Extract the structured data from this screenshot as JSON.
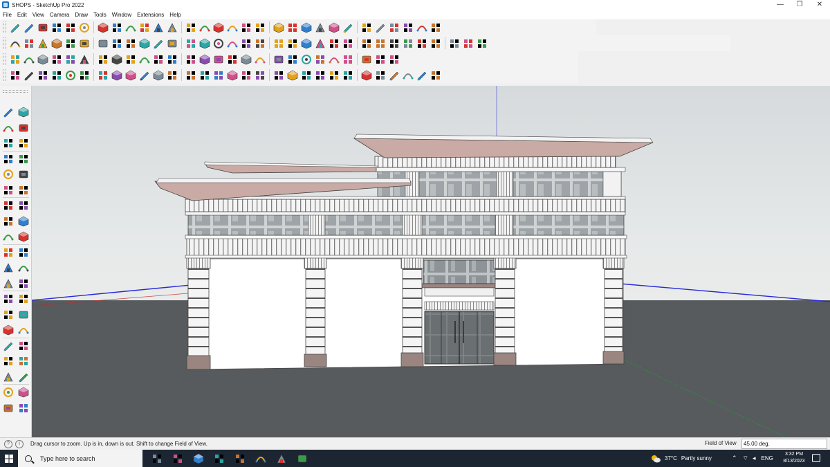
{
  "window": {
    "title": "SHOPS - SketchUp Pro 2022",
    "minimize_glyph": "—",
    "restore_glyph": "❐",
    "close_glyph": "✕"
  },
  "menu": [
    "File",
    "Edit",
    "View",
    "Camera",
    "Draw",
    "Tools",
    "Window",
    "Extensions",
    "Help"
  ],
  "toolbar_icons": {
    "row1": [
      "zoom-icon",
      "select-icon",
      "eraser-icon",
      "line-icon",
      "arc-icon",
      "rectangle-icon",
      "push-pull-icon",
      "follow-me-icon",
      "move-icon",
      "rotate-icon",
      "scale-icon",
      "tape-measure-icon",
      "text-icon",
      "paint-bucket-icon",
      "orbit-icon",
      "pan-icon",
      "zoom-window-icon",
      "zoom-extents-icon",
      "warehouse-icon",
      "layers-icon",
      "styles-icon",
      "account-icon",
      "section-plane-icon",
      "section-fill-icon",
      "axes-icon",
      "sandbox-icon",
      "solid-tools-icon",
      "undo-icon",
      "redo-icon",
      "sun-icon"
    ],
    "row2": [
      "iso-view-icon",
      "top-view-icon",
      "front-view-icon",
      "right-view-icon",
      "back-view-icon",
      "left-view-icon",
      "bottom-view-icon",
      "xray-icon",
      "wireframe-icon",
      "hidden-line-icon",
      "shaded-icon",
      "textured-icon",
      "monochrome-icon",
      "component-icon",
      "group-icon",
      "house-icon",
      "door-icon",
      "window-icon",
      "text-style-icon",
      "pencil-icon",
      "eraser-red-icon",
      "ring-icon",
      "ellipse-icon",
      "circle-icon",
      "polygon-icon",
      "grid-icon",
      "align-icon",
      "flip-icon",
      "join-icon",
      "render-icon",
      "texture-icon",
      "tag-icon",
      "box-icon"
    ],
    "row3": [
      "solid-union-icon",
      "offset-icon",
      "move-array-icon",
      "fillet-icon",
      "round-corner-icon",
      "bezier-icon",
      "intersect-icon",
      "extrude-icon",
      "curve-icon",
      "loft-icon",
      "weld-icon",
      "split-icon",
      "triangle-icon",
      "shell-icon",
      "cut-icon",
      "magnet-icon",
      "frame-icon",
      "subdivide-icon",
      "sweep-icon",
      "cloth-icon",
      "projection-icon",
      "flatten-icon",
      "unfold-icon",
      "sun-path-icon",
      "cross-icon",
      "pattern-icon",
      "label-icon"
    ],
    "row4": [
      "arc-tangent-icon",
      "spline-icon",
      "cap-icon",
      "box-3d-icon",
      "bend-icon",
      "twist-icon",
      "wire-icon",
      "layout-icon",
      "floor-icon",
      "wall-icon",
      "stair-icon",
      "roof-icon",
      "column-icon",
      "beam-icon",
      "slab-icon",
      "opening-icon",
      "rail-icon",
      "section-icon",
      "dimension-icon",
      "stretch-icon",
      "shear-icon",
      "taper-icon",
      "mirror-icon",
      "array-icon",
      "hatch-icon",
      "terrain-icon",
      "chamfer-icon",
      "gear-icon",
      "scene-icon",
      "export-icon"
    ]
  },
  "left_toolbar_icons": [
    "select-icon",
    "component-icon",
    "paint-bucket-icon",
    "eraser-icon",
    "material-icon",
    "pencil-icon",
    "line-icon",
    "freehand-icon",
    "rectangle-icon",
    "rotated-rectangle-icon",
    "circle-icon",
    "polygon-icon",
    "arc-icon",
    "pie-icon",
    "two-point-arc-icon",
    "three-point-arc-icon",
    "move-icon",
    "push-pull-icon",
    "rotate-icon",
    "follow-me-icon",
    "scale-icon",
    "offset-icon",
    "tape-measure-icon",
    "dimension-icon",
    "protractor-icon",
    "text-icon",
    "axes-icon",
    "3d-text-icon",
    "orbit-icon",
    "pan-icon",
    "zoom-icon",
    "zoom-window-icon",
    "zoom-extents-icon",
    "previous-view-icon",
    "position-camera-icon",
    "look-around-icon",
    "walk-icon",
    "section-plane-icon",
    "section-cut-icon",
    "display-section-icon"
  ],
  "status": {
    "text": "Drag cursor to zoom.  Up is in, down is out. Shift to change Field of View.",
    "fov_label": "Field of View",
    "fov_value": "45.00 deg."
  },
  "taskbar": {
    "search_placeholder": "Type here to search",
    "apps": [
      "task-view-icon",
      "calculator-icon",
      "file-explorer-icon",
      "autocad-icon",
      "revit-icon",
      "edge-icon",
      "sticky-notes-icon",
      "sketchup-icon"
    ],
    "weather_temp": "37°C",
    "weather_desc": "Partly sunny",
    "language": "ENG",
    "time": "3:32 PM",
    "date": "8/13/2023"
  },
  "colors": {
    "sky_top": "#d8dcde",
    "sky_bottom": "#eaecec",
    "ground": "#585b5d",
    "roof_slab": "#c9aaa5",
    "wall": "#ffffff",
    "blue_axis": "#2a2ad8",
    "red_axis": "#c0292b",
    "green_axis": "#1a9a3a",
    "taskbar": "#1c2633"
  }
}
